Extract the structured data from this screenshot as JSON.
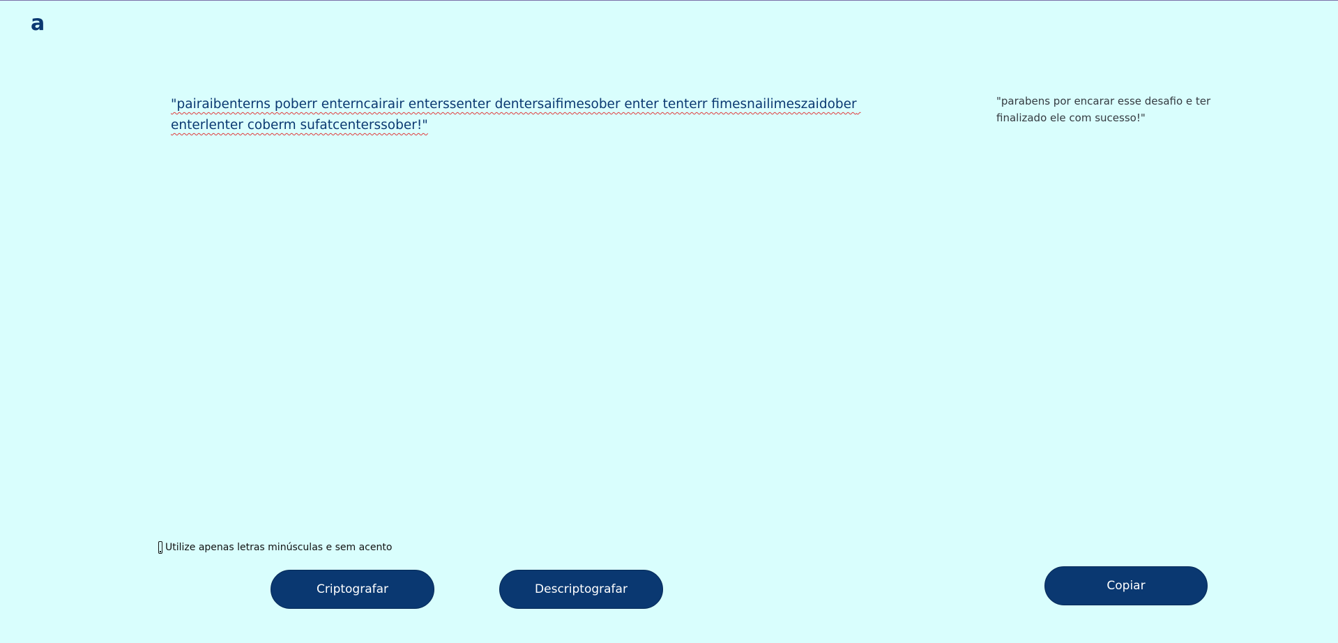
{
  "header": {
    "logo_text": "a"
  },
  "input": {
    "value": "\"pairaibenterns poberr enterncairair enterssenter dentersaifimesober enter tenterr fimesnailimeszaidober enterlenter coberm sufatcenterssober!\""
  },
  "output": {
    "text": "\"parabens por encarar esse desafio e ter finalizado ele com sucesso!\""
  },
  "info": {
    "icon": "exclamation-icon",
    "text": "Utilize apenas letras minúsculas e sem acento"
  },
  "buttons": {
    "encrypt_label": "Criptografar",
    "decrypt_label": "Descriptografar",
    "copy_label": "Copiar"
  },
  "colors": {
    "background": "#d9fefd",
    "primary": "#0a3871",
    "button_text": "#ffffff",
    "spellcheck_underline": "#e03a3a"
  }
}
